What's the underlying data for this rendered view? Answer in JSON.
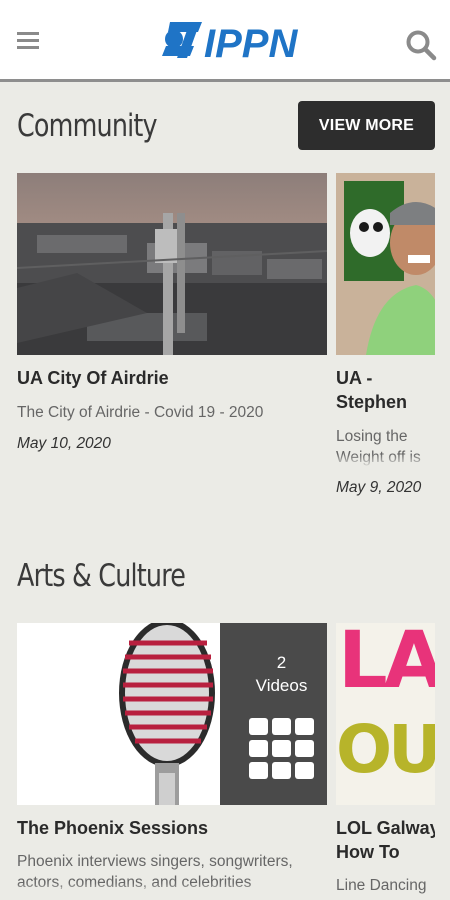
{
  "header": {
    "logo_text": "IPPN",
    "menu_icon": "hamburger-menu-icon",
    "search_icon": "search-icon",
    "brand_color": "#1f74c6"
  },
  "community": {
    "title": "Community",
    "view_more_label": "VIEW MORE",
    "cards": [
      {
        "title": "UA City Of Airdrie",
        "description": "The City of Airdrie - Covid 19 - 2020",
        "date": "May 10, 2020"
      },
      {
        "title": "UA - Stephen weight loss",
        "description": "Losing the Weight off is successful",
        "date": "May 9, 2020"
      }
    ]
  },
  "arts": {
    "title": "Arts & Culture",
    "cards": [
      {
        "title": "The Phoenix Sessions",
        "description": "Phoenix interviews singers, songwriters, actors, comedians, and celebrities",
        "video_count": "2",
        "video_label": "Videos",
        "grid_icon": "grid-icon"
      },
      {
        "title": "LOL Galway How To",
        "description": "Line Dancing",
        "thumb_text_top": "LA",
        "thumb_text_bottom": "OUT"
      }
    ]
  },
  "colors": {
    "background": "#ebebe6",
    "button_dark": "#2d2d2d",
    "overlay_gray": "#4a4a4a"
  }
}
